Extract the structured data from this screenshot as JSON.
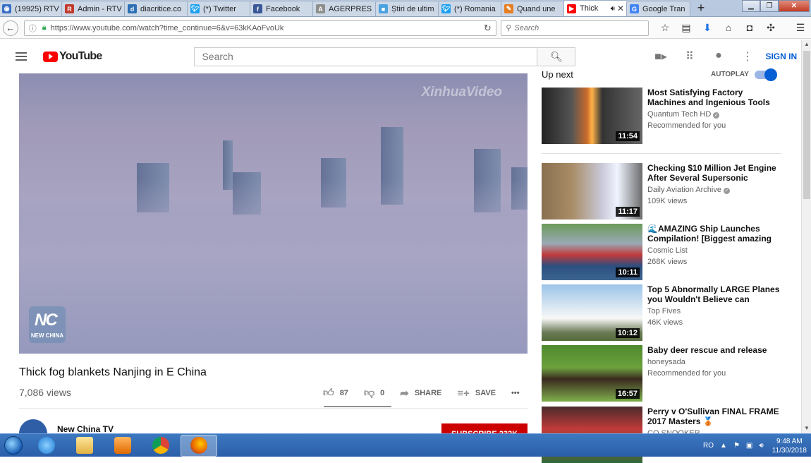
{
  "browser": {
    "tabs": [
      {
        "title": "(19925) RTV",
        "icon": "globe-icon",
        "color": "#3a6fc4"
      },
      {
        "title": "Admin - RTV",
        "icon": "r-icon",
        "color": "#c0392b"
      },
      {
        "title": "diacritice.co",
        "icon": "d-icon",
        "color": "#2c6fb3"
      },
      {
        "title": "(*) Twitter",
        "icon": "twitter-icon",
        "color": "#1da1f2"
      },
      {
        "title": "Facebook",
        "icon": "facebook-icon",
        "color": "#3b5998"
      },
      {
        "title": "AGERPRES -",
        "icon": "agerpres-icon",
        "color": "#8e8e8e"
      },
      {
        "title": "Știri de ultim",
        "icon": "news-icon",
        "color": "#4aa3df"
      },
      {
        "title": "(*) Romania",
        "icon": "twitter-icon",
        "color": "#1da1f2"
      },
      {
        "title": "Quand une",
        "icon": "pen-icon",
        "color": "#e67e22"
      },
      {
        "title": "Thick",
        "icon": "youtube-icon",
        "color": "#ff0000",
        "active": true
      },
      {
        "title": "Google Tran",
        "icon": "translate-icon",
        "color": "#4285f4"
      }
    ],
    "new_tab": "+",
    "url": "https://www.youtube.com/watch?time_continue=6&v=63kKAoFvoUk",
    "search_placeholder": "Search"
  },
  "youtube": {
    "logo_text": "YouTube",
    "search_placeholder": "Search",
    "sign_in": "SIGN IN",
    "video": {
      "watermark": "XinhuaVideo",
      "corner_logo": "NEW CHINA",
      "corner_logo_mark": "NC",
      "title": "Thick fog blankets Nanjing in E China",
      "views": "7,086 views",
      "likes": "87",
      "dislikes": "0",
      "share_label": "SHARE",
      "save_label": "SAVE",
      "more": "•••",
      "channel": "New China TV",
      "subscribe": "SUBSCRIBE 232K"
    },
    "sidebar": {
      "up_next": "Up next",
      "autoplay": "AUTOPLAY",
      "items": [
        {
          "title": "Most Satisfying Factory Machines and Ingenious Tools",
          "channel": "Quantum Tech HD",
          "verified": true,
          "meta": "Recommended for you",
          "duration": "11:54",
          "thumb": "factory"
        },
        {
          "title": "Checking $10 Million Jet Engine After Several Supersonic",
          "channel": "Daily Aviation Archive",
          "verified": true,
          "meta": "109K views",
          "duration": "11:17",
          "thumb": "jet"
        },
        {
          "title": "🌊AMAZING Ship Launches Compilation! [Biggest amazing",
          "channel": "Cosmic List",
          "verified": false,
          "meta": "268K views",
          "duration": "10:11",
          "thumb": "ship"
        },
        {
          "title": "Top 5 Abnormally LARGE Planes you Wouldn't Believe can",
          "channel": "Top Fives",
          "verified": false,
          "meta": "46K views",
          "duration": "10:12",
          "thumb": "plane"
        },
        {
          "title": "Baby deer rescue and release",
          "channel": "honeysada",
          "verified": false,
          "meta": "Recommended for you",
          "duration": "16:57",
          "thumb": "deer"
        },
        {
          "title": "Perry v O'Sullivan FINAL FRAME 2017 Masters 🥉",
          "channel": "CQ SNOOKER",
          "verified": false,
          "meta": "",
          "duration": "",
          "thumb": "snooker"
        }
      ]
    }
  },
  "taskbar": {
    "apps": [
      "start-orb",
      "ie-icon",
      "explorer-icon",
      "media-player-icon",
      "chrome-icon",
      "firefox-icon"
    ],
    "lang": "RO",
    "time": "9:48 AM",
    "date": "11/30/2018"
  }
}
